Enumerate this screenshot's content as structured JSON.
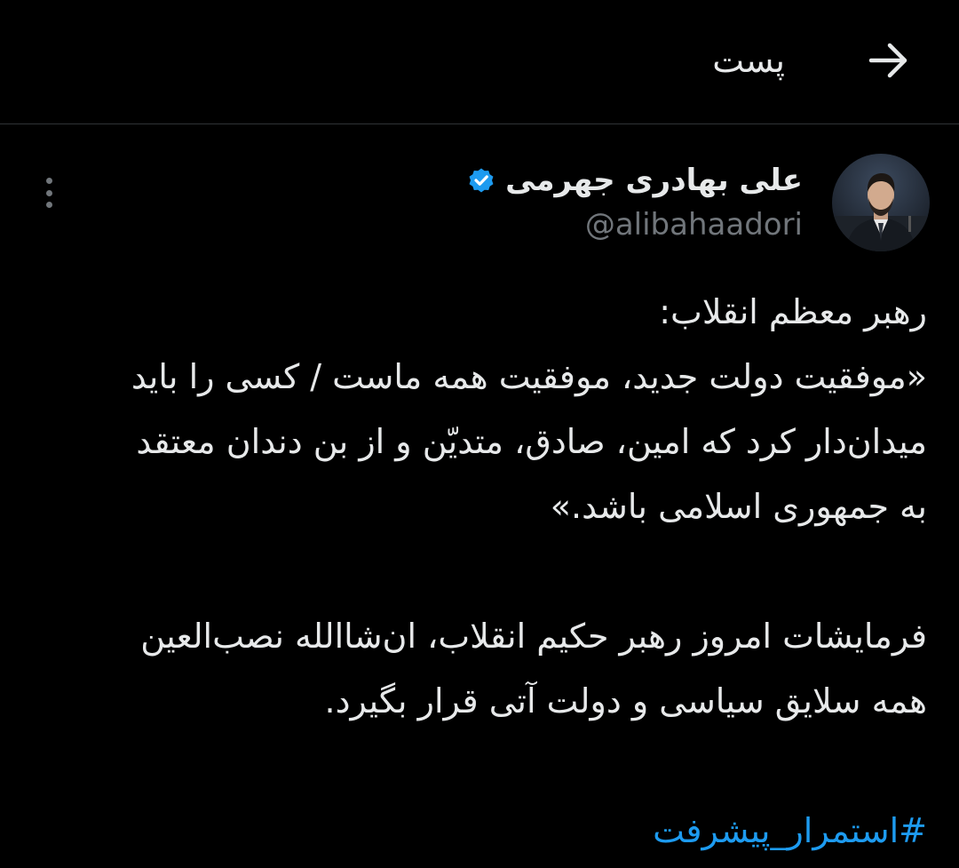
{
  "header": {
    "title": "پست",
    "back_icon": "arrow-right-icon"
  },
  "author": {
    "name": "علی بهادری جهرمی",
    "handle": "@alibahaadori",
    "verified": true,
    "verified_color": "#1d9bf0",
    "avatar_icon": "profile-photo"
  },
  "tweet": {
    "lines": [
      "رهبر معظم انقلاب:",
      "«موفقیت دولت جدید، موفقیت همه ماست / کسی را باید",
      "میدان‌دار کرد که امین، صادق، متدیّن و از بن دندان معتقد",
      "به جمهوری اسلامی باشد.»",
      "فرمایشات امروز رهبر حکیم انقلاب، ان‌شاالله نصب‌العین",
      "همه سلایق سیاسی و دولت آتی قرار بگیرد."
    ],
    "hashtag": "#استمرار_پیشرفت",
    "hashtag_color": "#1d9bf0"
  },
  "colors": {
    "background": "#000000",
    "text": "#e7e9ea",
    "muted": "#71767b",
    "divider": "#2f3336"
  }
}
